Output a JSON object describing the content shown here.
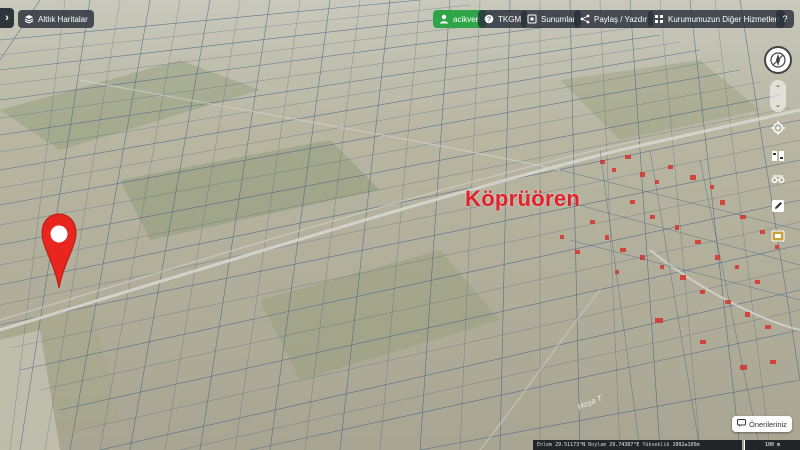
{
  "topbar": {
    "historic_maps_label": "Altlık Haritalar",
    "user_label": "acikveri",
    "tkgm_label": "TKGM",
    "presentations_label": "Sunumlar",
    "share_print_label": "Paylaş / Yazdır",
    "other_services_label": "Kurumumuzun Diğer Hizmetleri",
    "help_label": "?"
  },
  "map": {
    "place_name": "Köprüören",
    "road_label": "Hoşa T",
    "colors": {
      "parcel_lines": "#3e5b86",
      "place_label": "#e4202b",
      "building_red": "#d8332f",
      "marker": "#e8261f"
    }
  },
  "right_tools": [
    "compass-icon",
    "target-icon",
    "split-view-icon",
    "measure-icon",
    "draw-icon",
    "layers-icon"
  ],
  "feedback": {
    "label": "Önerileriniz"
  },
  "status": {
    "lat_label": "Enlem",
    "lat_value": "29.51173°N",
    "lon_label": "Boylam",
    "lon_value": "29.74387°E",
    "elevation_label": "Yükseklik",
    "elevation_value": "1092±105m",
    "scale_label": "100 m"
  }
}
